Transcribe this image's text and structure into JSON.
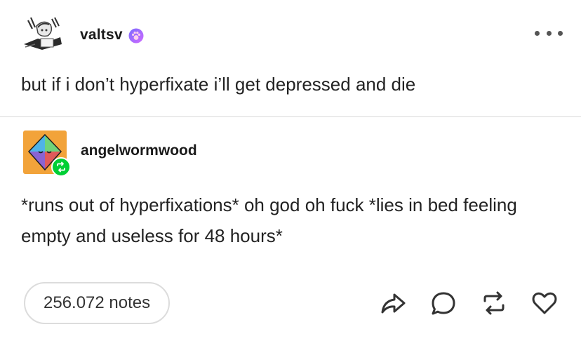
{
  "post": {
    "author": "valtsv",
    "text": "but if i don’t hyperfixate i’ll get depressed and die"
  },
  "reblog": {
    "author": "angelwormwood",
    "text": "*runs out of hyperfixations* oh god oh fuck *lies in bed feeling empty and useless for 48 hours*"
  },
  "footer": {
    "notes": "256.072 notes"
  },
  "icons": {
    "badge": "paw-icon",
    "more": "more-icon",
    "reblog_badge": "reblog-icon",
    "share": "share-icon",
    "reply": "reply-icon",
    "reblog": "reblog-icon",
    "like": "heart-icon"
  },
  "colors": {
    "reblog_green": "#00cf35",
    "badge_purple": "#a66bff",
    "avatar_orange": "#f2a33a"
  }
}
